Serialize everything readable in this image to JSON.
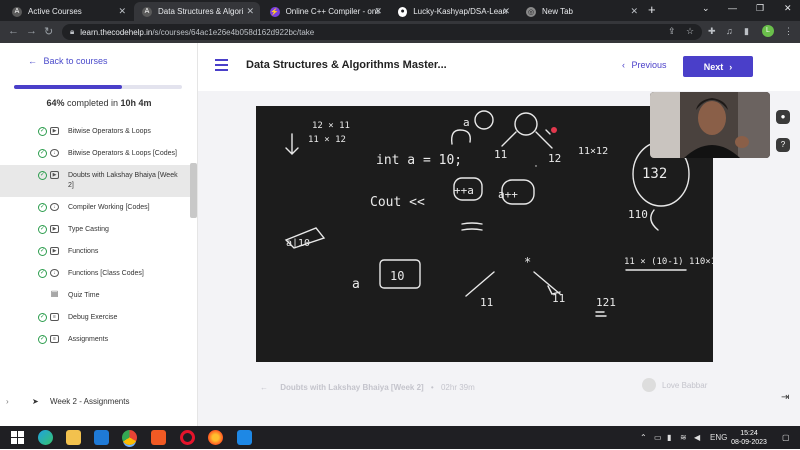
{
  "browser": {
    "tabs": [
      {
        "label": "Active Courses",
        "icon_color": "#5a5a5a",
        "icon_glyph": "A"
      },
      {
        "label": "Data Structures & Algori",
        "icon_color": "#5a5a5a",
        "icon_glyph": "A"
      },
      {
        "label": "Online C++ Compiler - onlin",
        "icon_color": "#7a3fe0",
        "icon_glyph": "⚡"
      },
      {
        "label": "Lucky-Kashyap/DSA-Learnin",
        "icon_color": "#ffffff",
        "icon_glyph": "●"
      },
      {
        "label": "New Tab",
        "icon_color": "#8a8a8a",
        "icon_glyph": "◎"
      }
    ],
    "url_host": "learn.thecodehelp.in",
    "url_path": "/s/courses/64ac1e26e4b058d162d922bc/take",
    "profile_initial": "L"
  },
  "sidebar": {
    "back_label": "Back to courses",
    "progress_percent": 64,
    "progress_pct_label": "64%",
    "progress_mid": " completed in ",
    "progress_time": "10h 4m",
    "lessons": [
      {
        "label": "Bitwise Operators & Loops",
        "kind": "video",
        "current": false
      },
      {
        "label": "Bitwise Operators & Loops [Codes]",
        "kind": "code",
        "current": false
      },
      {
        "label": "Doubts with Lakshay Bhaiya [Week 2]",
        "kind": "video",
        "current": true
      },
      {
        "label": "Compiler Working [Codes]",
        "kind": "code",
        "current": false
      },
      {
        "label": "Type Casting",
        "kind": "video",
        "current": false
      },
      {
        "label": "Functions",
        "kind": "video",
        "current": false
      },
      {
        "label": "Functions [Class Codes]",
        "kind": "code",
        "current": false
      },
      {
        "label": "Quiz Time",
        "kind": "quiz",
        "current": false
      },
      {
        "label": "Debug Exercise",
        "kind": "doc",
        "current": false
      },
      {
        "label": "Assignments",
        "kind": "doc",
        "current": false
      }
    ],
    "week_label": "Week 2 - Assignments"
  },
  "main": {
    "title": "Data Structures & Algorithms Master...",
    "prev_label": "Previous",
    "next_label": "Next",
    "bottom_lesson": "Doubts with Lakshay Bhaiya [Week 2]",
    "bottom_duration": "02hr 39m",
    "author": "Love Babbar"
  },
  "taskbar": {
    "lang": "ENG",
    "time": "15:24",
    "date": "08-09-2023"
  },
  "colors": {
    "accent": "#4a3fc9",
    "done": "#2e9e4f"
  }
}
